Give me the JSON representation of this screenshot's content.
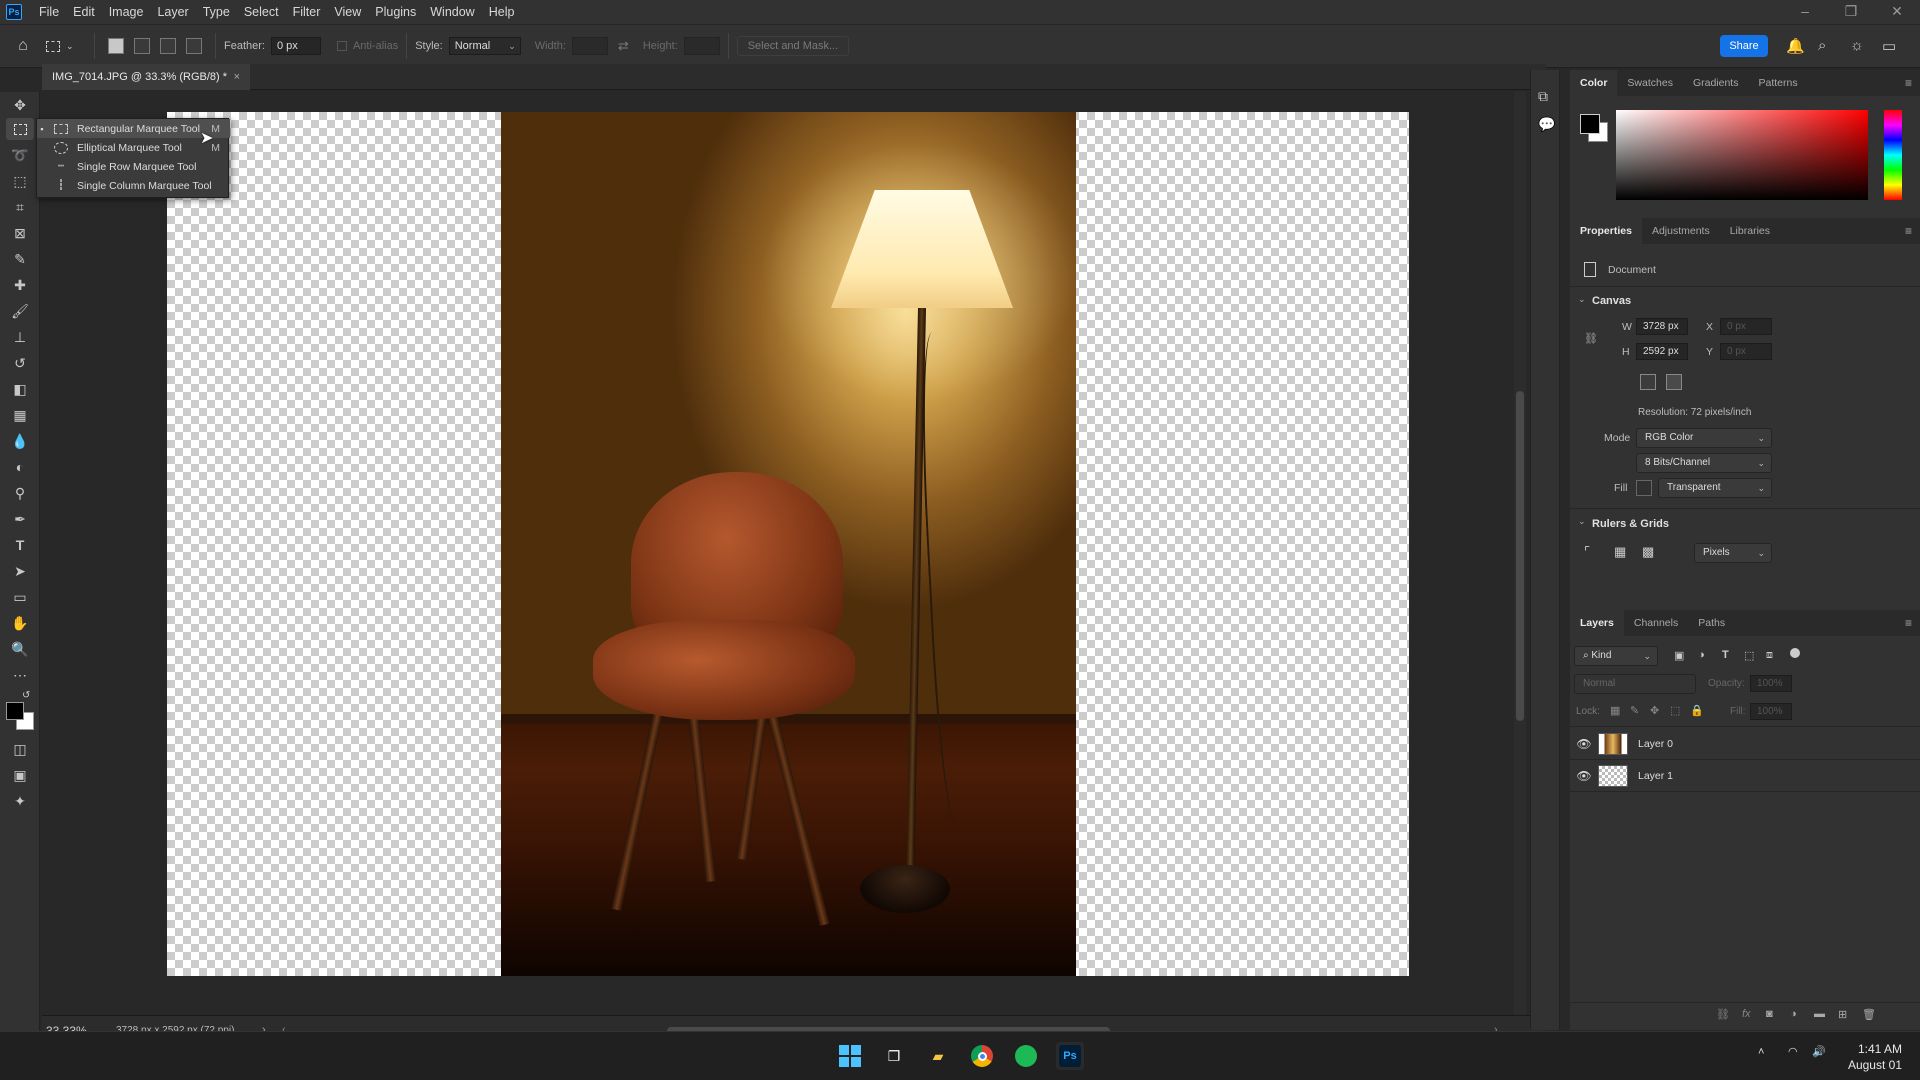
{
  "menubar": {
    "app_logo": "Ps",
    "items": [
      "File",
      "Edit",
      "Image",
      "Layer",
      "Type",
      "Select",
      "Filter",
      "View",
      "Plugins",
      "Window",
      "Help"
    ]
  },
  "options_bar": {
    "feather_label": "Feather:",
    "feather_value": "0 px",
    "anti_alias_label": "Anti-alias",
    "style_label": "Style:",
    "style_value": "Normal",
    "width_label": "Width:",
    "height_label": "Height:",
    "select_mask_label": "Select and Mask...",
    "share_label": "Share"
  },
  "document": {
    "tab_title": "IMG_7014.JPG @ 33.3% (RGB/8) *",
    "close_glyph": "×"
  },
  "tool_flyout": {
    "items": [
      {
        "label": "Rectangular Marquee Tool",
        "key": "M",
        "selected": true
      },
      {
        "label": "Elliptical Marquee Tool",
        "key": "M",
        "selected": false
      },
      {
        "label": "Single Row Marquee Tool",
        "key": "",
        "selected": false
      },
      {
        "label": "Single Column Marquee Tool",
        "key": "",
        "selected": false
      }
    ]
  },
  "status": {
    "zoom": "33.33%",
    "doc_info": "3728 px x 2592 px (72 ppi)"
  },
  "color_panel": {
    "tabs": [
      "Color",
      "Swatches",
      "Gradients",
      "Patterns"
    ],
    "foreground": "#000000",
    "background": "#ffffff",
    "hue_color": "#ff0000"
  },
  "properties_panel": {
    "tabs": [
      "Properties",
      "Adjustments",
      "Libraries"
    ],
    "document_label": "Document",
    "canvas_title": "Canvas",
    "w_label": "W",
    "w_value": "3728 px",
    "h_label": "H",
    "h_value": "2592 px",
    "x_label": "X",
    "x_value": "0 px",
    "y_label": "Y",
    "y_value": "0 px",
    "resolution": "Resolution: 72 pixels/inch",
    "mode_label": "Mode",
    "mode_value": "RGB Color",
    "bits_value": "8 Bits/Channel",
    "fill_label": "Fill",
    "fill_value": "Transparent",
    "rulers_title": "Rulers & Grids",
    "units_value": "Pixels"
  },
  "layers_panel": {
    "tabs": [
      "Layers",
      "Channels",
      "Paths"
    ],
    "filter_kind": "Kind",
    "blend_mode": "Normal",
    "opacity_label": "Opacity:",
    "opacity_value": "100%",
    "lock_label": "Lock:",
    "fill_label": "Fill:",
    "fill_value": "100%",
    "layers": [
      {
        "name": "Layer 0",
        "visible": true
      },
      {
        "name": "Layer 1",
        "visible": true
      }
    ]
  },
  "taskbar": {
    "time": "1:41 AM",
    "date": "August 01"
  }
}
